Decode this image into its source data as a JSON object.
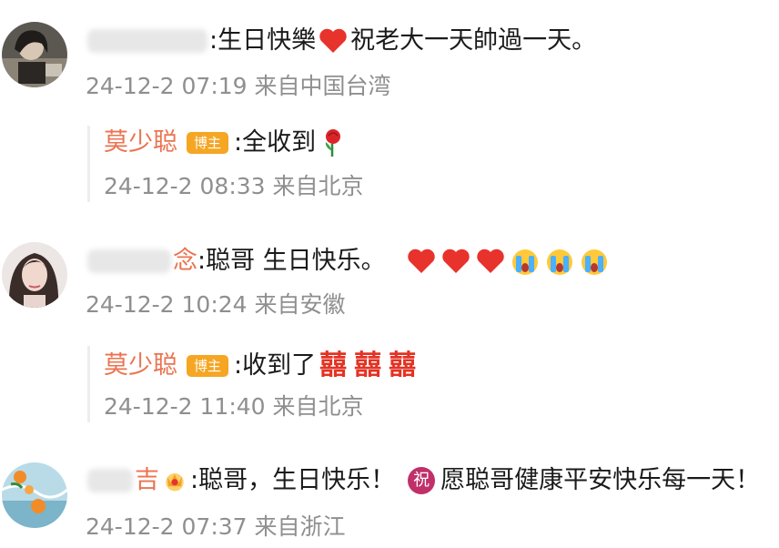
{
  "comments": [
    {
      "avatar": "avatar-photo-woman-1",
      "text": ":生日快樂",
      "text_after": " 祝老大一天帥過一天。",
      "time": "24-12-2 07:19 来自中国台湾",
      "reply": {
        "author": "莫少聪",
        "badge": "博主",
        "text": ":全收到",
        "time": "24-12-2 08:33 来自北京"
      }
    },
    {
      "avatar": "avatar-photo-woman-2",
      "name_tail": "念",
      "text": ":聪哥 生日快乐。",
      "time": "24-12-2 10:24 来自安徽",
      "reply": {
        "author": "莫少聪",
        "badge": "博主",
        "text": ":收到了",
        "xi": "囍",
        "time": "24-12-2 11:40 来自北京"
      }
    },
    {
      "avatar": "avatar-photo-oranges",
      "name_tail": "吉",
      "text": ":聪哥，生日快乐！",
      "zhu": "祝",
      "text_after": "愿聪哥健康平安快乐每一天！",
      "time": "24-12-2 07:37 来自浙江"
    }
  ],
  "colors": {
    "name": "#eb7350",
    "meta": "#8f8f8f",
    "heart": "#e8322c",
    "badge": "#f5a623"
  }
}
